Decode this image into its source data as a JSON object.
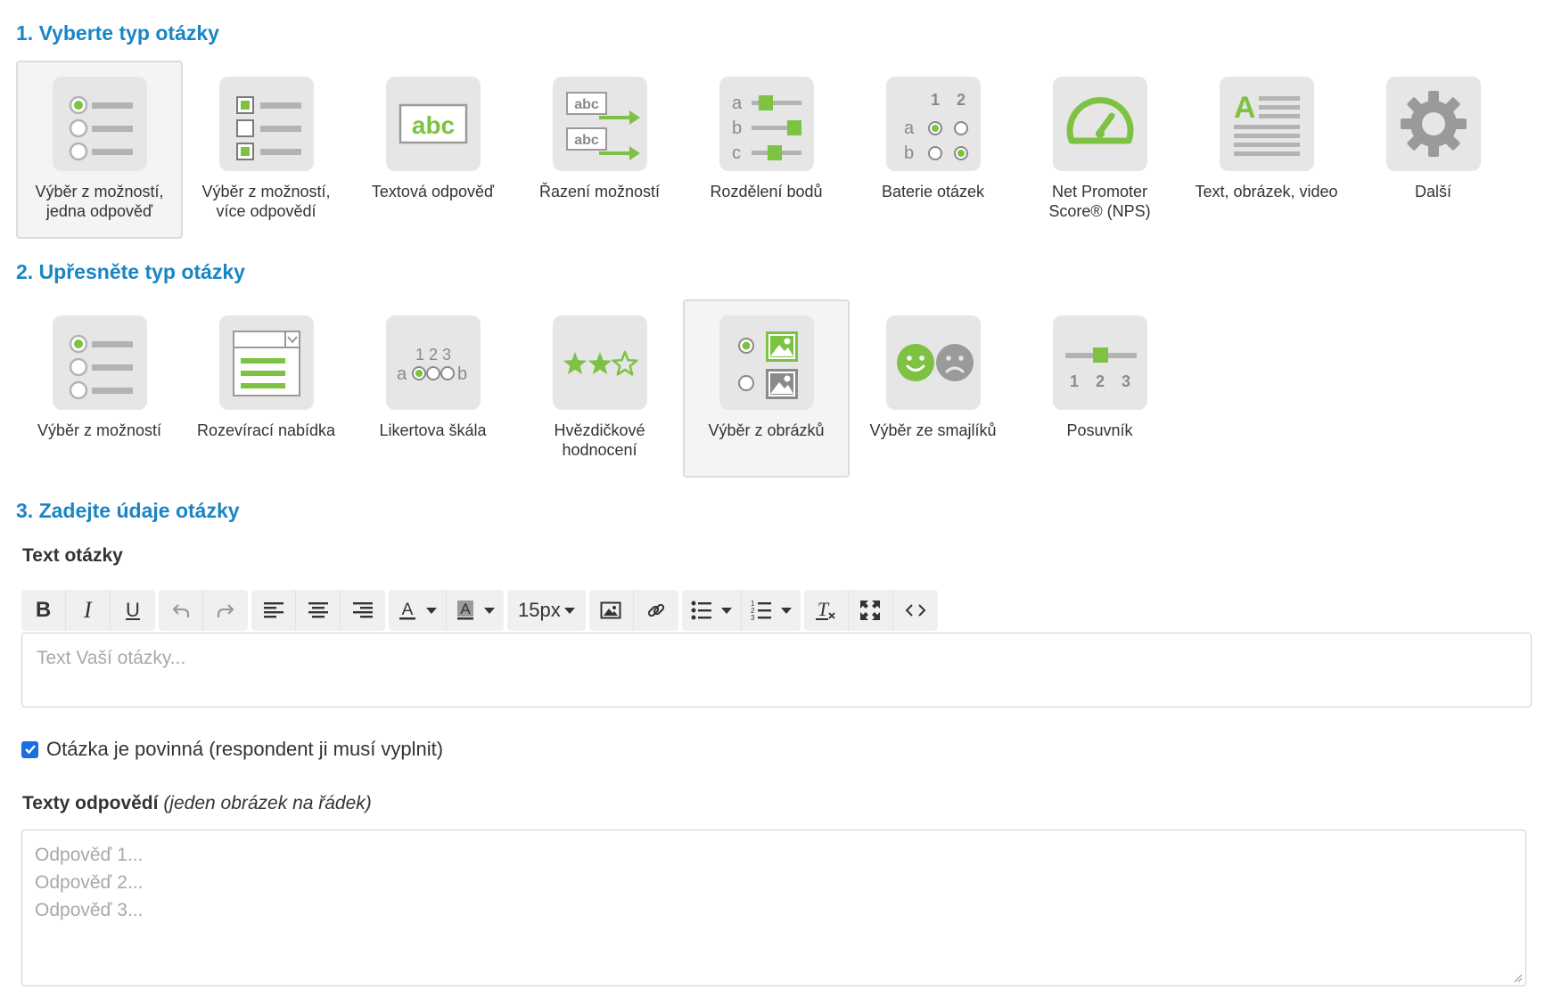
{
  "section1": {
    "title": "1. Vyberte typ otázky",
    "items": [
      {
        "label": "Výběr z možností, jedna odpověď",
        "icon": "radio-list-icon",
        "selected": true
      },
      {
        "label": "Výběr z možností, více odpovědí",
        "icon": "checkbox-list-icon",
        "selected": false
      },
      {
        "label": "Textová odpověď",
        "icon": "text-answer-icon",
        "selected": false
      },
      {
        "label": "Řazení možností",
        "icon": "ordering-icon",
        "selected": false
      },
      {
        "label": "Rozdělení bodů",
        "icon": "points-split-icon",
        "selected": false
      },
      {
        "label": "Baterie otázek",
        "icon": "matrix-icon",
        "selected": false
      },
      {
        "label": "Net Promoter Score® (NPS)",
        "icon": "gauge-icon",
        "selected": false
      },
      {
        "label": "Text, obrázek, video",
        "icon": "text-block-icon",
        "selected": false
      },
      {
        "label": "Další",
        "icon": "gear-icon",
        "selected": false
      }
    ]
  },
  "section2": {
    "title": "2. Upřesněte typ otázky",
    "items": [
      {
        "label": "Výběr z možností",
        "icon": "radio-list-icon",
        "selected": false
      },
      {
        "label": "Rozevírací nabídka",
        "icon": "dropdown-icon",
        "selected": false
      },
      {
        "label": "Likertova škála",
        "icon": "likert-icon",
        "selected": false
      },
      {
        "label": "Hvězdičkové hodnocení",
        "icon": "stars-icon",
        "selected": false
      },
      {
        "label": "Výběr z obrázků",
        "icon": "image-choice-icon",
        "selected": true
      },
      {
        "label": "Výběr ze smajlíků",
        "icon": "smileys-icon",
        "selected": false
      },
      {
        "label": "Posuvník",
        "icon": "slider-icon",
        "selected": false
      }
    ]
  },
  "section3": {
    "title": "3. Zadejte údaje otázky",
    "question_label": "Text otázky",
    "toolbar": {
      "font_size": "15px",
      "buttons": [
        "bold-icon",
        "italic-icon",
        "underline-icon",
        "undo-icon",
        "redo-icon",
        "align-left-icon",
        "align-center-icon",
        "align-right-icon",
        "text-color-icon",
        "background-color-icon",
        "font-size",
        "image-icon",
        "link-icon",
        "bullet-list-icon",
        "numbered-list-icon",
        "clear-format-icon",
        "fullscreen-icon",
        "code-view-icon"
      ]
    },
    "question_placeholder": "Text Vaší otázky...",
    "required_label": "Otázka je povinná (respondent ji musí vyplnit)",
    "required_checked": true,
    "answers_label": "Texty odpovědí",
    "answers_hint": "(jeden obrázek na řádek)",
    "answers_placeholder": [
      "Odpověď 1...",
      "Odpověď 2...",
      "Odpověď 3..."
    ]
  },
  "colors": {
    "accent_blue": "#1a85c4",
    "icon_green": "#7dc242",
    "icon_gray": "#b3b3b3",
    "tile_bg": "#e6e6e6",
    "checkbox_blue": "#1a6fe0"
  }
}
